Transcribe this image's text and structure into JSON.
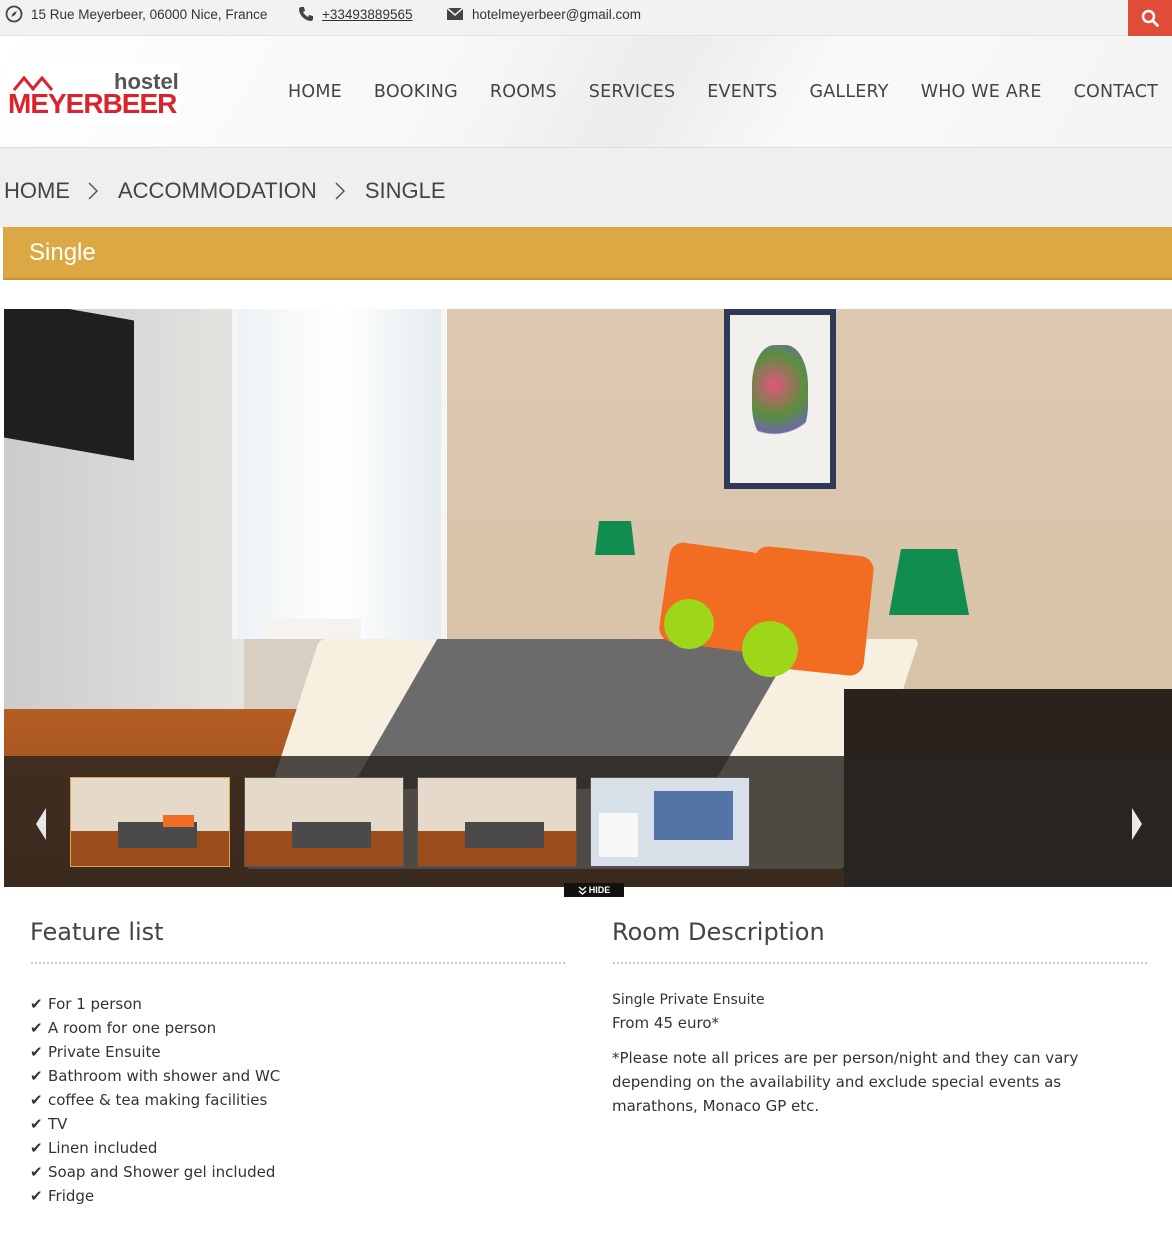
{
  "topbar": {
    "address": "15 Rue Meyerbeer, 06000 Nice, France",
    "phone": "+33493889565",
    "email": "hotelmeyerbeer@gmail.com"
  },
  "logo": {
    "small": "hostel",
    "brand": "MEYERBEER"
  },
  "nav": {
    "items": [
      "HOME",
      "BOOKING",
      "ROOMS",
      "SERVICES",
      "EVENTS",
      "GALLERY",
      "WHO WE ARE",
      "CONTACT"
    ]
  },
  "breadcrumb": {
    "items": [
      "HOME",
      "ACCOMMODATION",
      "SINGLE"
    ]
  },
  "page": {
    "title": "Single"
  },
  "gallery": {
    "hide_label": "HIDE"
  },
  "features": {
    "heading": "Feature list",
    "items": [
      "For 1 person",
      "A room for one person",
      "Private Ensuite",
      "Bathroom with shower and WC",
      "coffee & tea making facilities",
      "TV",
      "Linen included",
      "Soap and Shower gel included",
      "Fridge"
    ]
  },
  "description": {
    "heading": "Room Description",
    "line1": "Single Private Ensuite",
    "line2": "From 45 euro*",
    "note": "*Please note all prices are per person/night and they can vary depending on the availability and exclude special events as marathons, Monaco GP etc."
  },
  "colors": {
    "accent": "#dba843",
    "search": "#e04b3a",
    "brand_red": "#d9242d"
  }
}
